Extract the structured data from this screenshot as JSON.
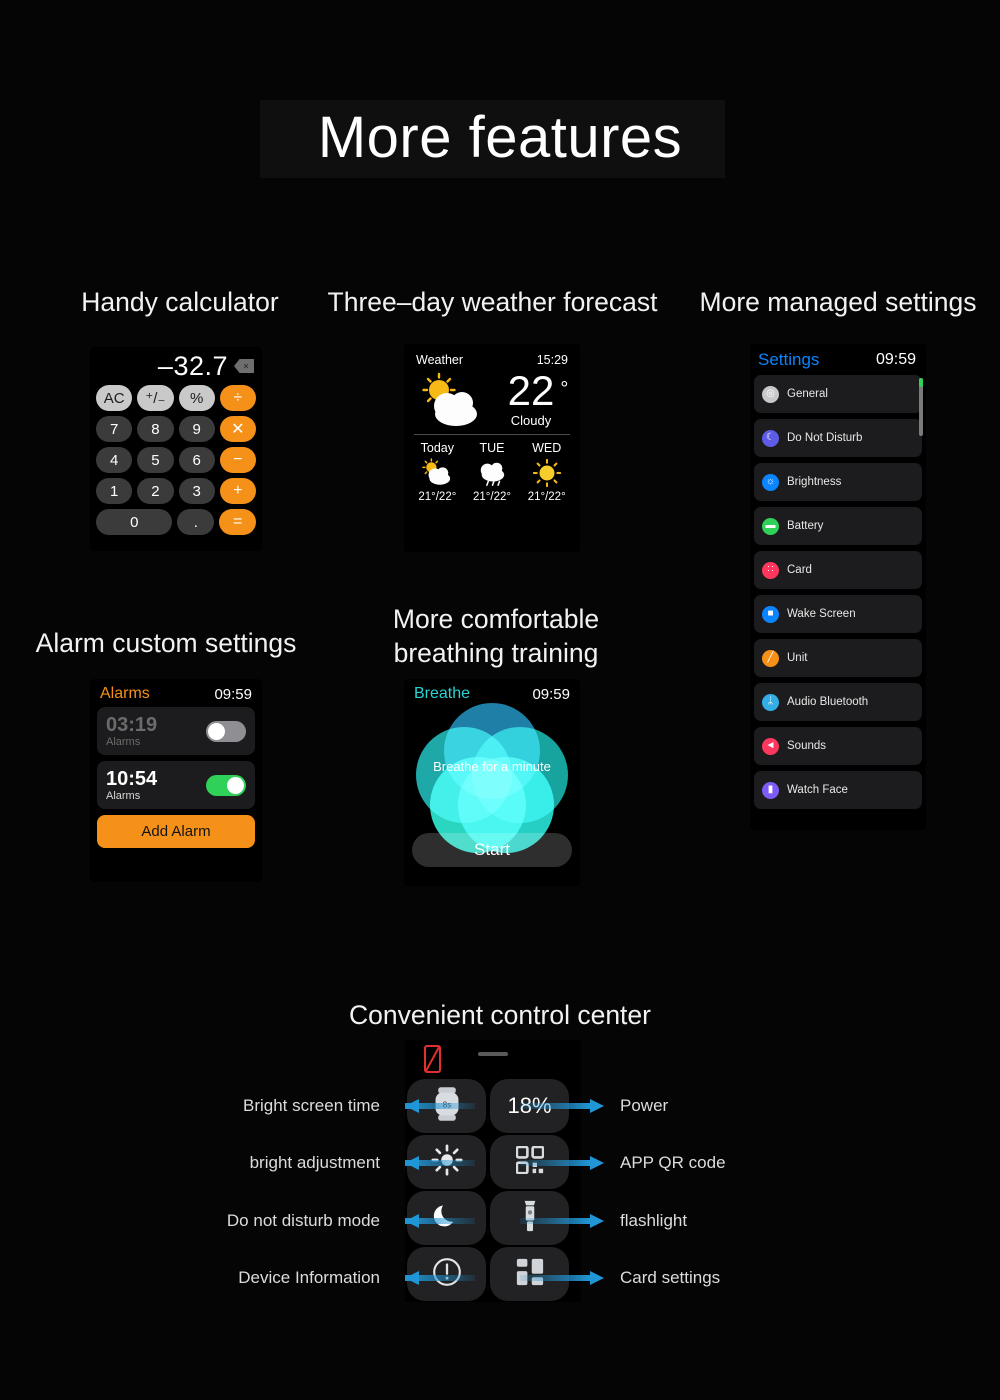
{
  "page": {
    "title": "More features",
    "background": "#050505"
  },
  "sections": {
    "calculator": {
      "heading": "Handy calculator"
    },
    "weather": {
      "heading": "Three–day weather forecast"
    },
    "settings": {
      "heading": "More managed settings"
    },
    "alarm": {
      "heading": "Alarm custom settings"
    },
    "breathe": {
      "heading_line1": "More comfortable",
      "heading_line2": "breathing training"
    },
    "control": {
      "heading": "Convenient control center"
    }
  },
  "calculator": {
    "display_value": "–32.7",
    "delete_icon": "backspace-icon",
    "accent": "#f59019",
    "rows": [
      [
        {
          "label": "AC",
          "type": "fn"
        },
        {
          "label": "⁺/₋",
          "type": "fn"
        },
        {
          "label": "%",
          "type": "fn"
        },
        {
          "label": "÷",
          "type": "op"
        }
      ],
      [
        {
          "label": "7",
          "type": "num"
        },
        {
          "label": "8",
          "type": "num"
        },
        {
          "label": "9",
          "type": "num"
        },
        {
          "label": "✕",
          "type": "op"
        }
      ],
      [
        {
          "label": "4",
          "type": "num"
        },
        {
          "label": "5",
          "type": "num"
        },
        {
          "label": "6",
          "type": "num"
        },
        {
          "label": "−",
          "type": "op"
        }
      ],
      [
        {
          "label": "1",
          "type": "num"
        },
        {
          "label": "2",
          "type": "num"
        },
        {
          "label": "3",
          "type": "num"
        },
        {
          "label": "+",
          "type": "op"
        }
      ],
      [
        {
          "label": "0",
          "type": "zero"
        },
        {
          "label": ".",
          "type": "num"
        },
        {
          "label": "=",
          "type": "op"
        }
      ]
    ]
  },
  "weather": {
    "app_label": "Weather",
    "time": "15:29",
    "temperature": "22",
    "degree": "°",
    "condition": "Cloudy",
    "current_icon": "sun-behind-cloud-icon",
    "forecast": [
      {
        "day": "Today",
        "icon": "sun-behind-cloud-icon",
        "range": "21°/22°"
      },
      {
        "day": "TUE",
        "icon": "cloud-with-rain-icon",
        "range": "21°/22°"
      },
      {
        "day": "WED",
        "icon": "sun-icon",
        "range": "21°/22°"
      }
    ]
  },
  "settings": {
    "title": "Settings",
    "title_color": "#0a84ff",
    "time": "09:59",
    "scroll_indicator_color": "#2fd158",
    "items": [
      {
        "label": "General",
        "icon": "gear-icon",
        "color": "#c7c7cc",
        "glyph": "◎"
      },
      {
        "label": "Do Not Disturb",
        "icon": "moon-icon",
        "color": "#5e5ce6",
        "glyph": "☾"
      },
      {
        "label": "Brightness",
        "icon": "brightness-icon",
        "color": "#0a84ff",
        "glyph": "☼"
      },
      {
        "label": "Battery",
        "icon": "battery-icon",
        "color": "#2fd158",
        "glyph": "▬"
      },
      {
        "label": "Card",
        "icon": "card-icon",
        "color": "#ff375f",
        "glyph": "∷"
      },
      {
        "label": "Wake Screen",
        "icon": "wake-screen-icon",
        "color": "#0a84ff",
        "glyph": "■"
      },
      {
        "label": "Unit",
        "icon": "unit-icon",
        "color": "#f59019",
        "glyph": "╱"
      },
      {
        "label": "Audio Bluetooth",
        "icon": "bluetooth-icon",
        "color": "#32ade6",
        "glyph": "ᛦ"
      },
      {
        "label": "Sounds",
        "icon": "speaker-icon",
        "color": "#ff375f",
        "glyph": "◄"
      },
      {
        "label": "Watch Face",
        "icon": "watch-face-icon",
        "color": "#7d5cf6",
        "glyph": "▮"
      }
    ]
  },
  "alarm": {
    "title": "Alarms",
    "title_color": "#f59019",
    "time": "09:59",
    "add_button": "Add Alarm",
    "items": [
      {
        "time": "03:19",
        "label": "Alarms",
        "enabled": false
      },
      {
        "time": "10:54",
        "label": "Alarms",
        "enabled": true
      }
    ]
  },
  "breathe": {
    "title": "Breathe",
    "title_color": "#2ad3d3",
    "time": "09:59",
    "caption": "Breathe for a minute",
    "start_button": "Start"
  },
  "control_center": {
    "battery_icon": "battery-disabled-icon",
    "drag_handle": "drag-handle",
    "tiles": [
      {
        "icon": "watch-screen-time-icon",
        "value": "8s",
        "left_label": "Bright screen time",
        "right_label": null
      },
      {
        "icon": "battery-percent-icon",
        "value": "18%",
        "left_label": null,
        "right_label": "Power"
      },
      {
        "icon": "brightness-icon",
        "value": null,
        "left_label": "bright adjustment",
        "right_label": null
      },
      {
        "icon": "qr-code-icon",
        "value": null,
        "left_label": null,
        "right_label": "APP QR code"
      },
      {
        "icon": "moon-icon",
        "value": null,
        "left_label": "Do not disturb mode",
        "right_label": null
      },
      {
        "icon": "flashlight-icon",
        "value": null,
        "left_label": null,
        "right_label": "flashlight"
      },
      {
        "icon": "exclamation-circle-icon",
        "value": null,
        "left_label": "Device Information",
        "right_label": null
      },
      {
        "icon": "card-grid-icon",
        "value": null,
        "left_label": null,
        "right_label": "Card settings"
      }
    ],
    "left_labels": [
      "Bright screen time",
      "bright adjustment",
      "Do not disturb mode",
      "Device Information"
    ],
    "right_labels": [
      "Power",
      "APP QR code",
      "flashlight",
      "Card settings"
    ],
    "arrow_color": "#2196d6"
  }
}
